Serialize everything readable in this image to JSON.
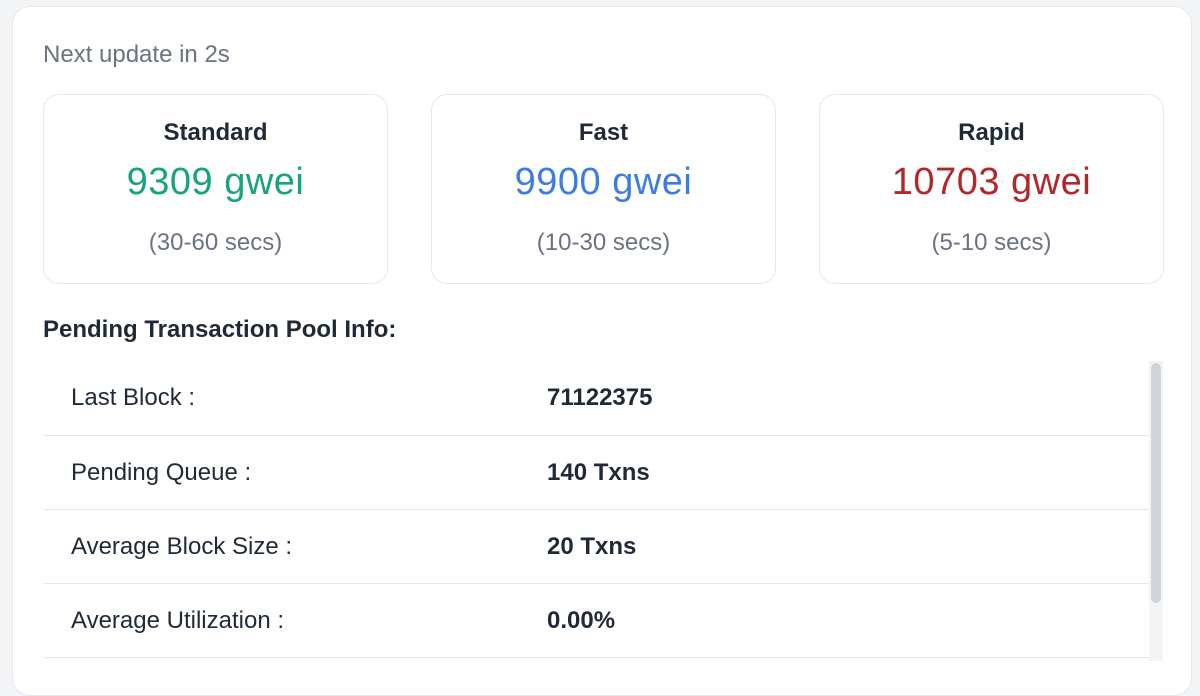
{
  "update_status": "Next update in 2s",
  "tiers": [
    {
      "name": "Standard",
      "price": "9309 gwei",
      "time": "(30-60 secs)",
      "color": "#16a37f"
    },
    {
      "name": "Fast",
      "price": "9900 gwei",
      "time": "(10-30 secs)",
      "color": "#3b7de0"
    },
    {
      "name": "Rapid",
      "price": "10703 gwei",
      "time": "(5-10 secs)",
      "color": "#b3262b"
    }
  ],
  "pool": {
    "title": "Pending Transaction Pool Info:",
    "rows": [
      {
        "label": "Last Block :",
        "value": "71122375"
      },
      {
        "label": "Pending Queue :",
        "value": "140 Txns"
      },
      {
        "label": "Average Block Size :",
        "value": "20 Txns"
      },
      {
        "label": "Average Utilization :",
        "value": "0.00%"
      }
    ]
  }
}
